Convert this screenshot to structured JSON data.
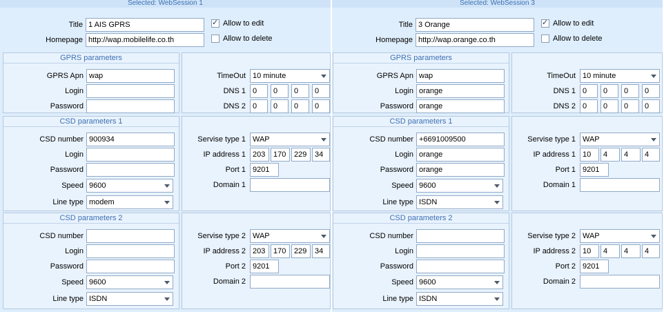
{
  "sessions": [
    {
      "header": "Selected: WebSession 1",
      "title_label": "Title",
      "title_value": "1 AIS GPRS",
      "homepage_label": "Homepage",
      "homepage_value": "http://wap.mobilelife.co.th",
      "allow_edit": {
        "label": "Allow to edit",
        "checked": true
      },
      "allow_delete": {
        "label": "Allow to delete",
        "checked": false
      },
      "gprs": {
        "title": "GPRS parameters",
        "apn_label": "GPRS Apn",
        "apn": "wap",
        "login_label": "Login",
        "login": "",
        "password_label": "Password",
        "password": "",
        "timeout_label": "TimeOut",
        "timeout": "10 minute",
        "dns1_label": "DNS 1",
        "dns1": [
          "0",
          "0",
          "0",
          "0"
        ],
        "dns2_label": "DNS 2",
        "dns2": [
          "0",
          "0",
          "0",
          "0"
        ]
      },
      "csd1": {
        "title": "CSD parameters 1",
        "number_label": "CSD number",
        "number": "900934",
        "login_label": "Login",
        "login": "",
        "password_label": "Password",
        "password": "",
        "speed_label": "Speed",
        "speed": "9600",
        "linetype_label": "Line type",
        "linetype": "modem",
        "service_label": "Servise type 1",
        "service": "WAP",
        "ip_label": "IP address 1",
        "ip": [
          "203",
          "170",
          "229",
          "34"
        ],
        "port_label": "Port 1",
        "port": "9201",
        "domain_label": "Domain 1",
        "domain": ""
      },
      "csd2": {
        "title": "CSD parameters 2",
        "number_label": "CSD number",
        "number": "",
        "login_label": "Login",
        "login": "",
        "password_label": "Password",
        "password": "",
        "speed_label": "Speed",
        "speed": "9600",
        "linetype_label": "Line type",
        "linetype": "ISDN",
        "service_label": "Servise type 2",
        "service": "WAP",
        "ip_label": "IP address 2",
        "ip": [
          "203",
          "170",
          "229",
          "34"
        ],
        "port_label": "Port 2",
        "port": "9201",
        "domain_label": "Domain 2",
        "domain": ""
      }
    },
    {
      "header": "Selected: WebSession 3",
      "title_label": "Title",
      "title_value": "3 Orange",
      "homepage_label": "Homepage",
      "homepage_value": "http://wap.orange.co.th",
      "allow_edit": {
        "label": "Allow to edit",
        "checked": true
      },
      "allow_delete": {
        "label": "Allow to delete",
        "checked": false
      },
      "gprs": {
        "title": "GPRS parameters",
        "apn_label": "GPRS Apn",
        "apn": "wap",
        "login_label": "Login",
        "login": "orange",
        "password_label": "Password",
        "password": "orange",
        "timeout_label": "TimeOut",
        "timeout": "10 minute",
        "dns1_label": "DNS 1",
        "dns1": [
          "0",
          "0",
          "0",
          "0"
        ],
        "dns2_label": "DNS 2",
        "dns2": [
          "0",
          "0",
          "0",
          "0"
        ]
      },
      "csd1": {
        "title": "CSD parameters 1",
        "number_label": "CSD number",
        "number": "+6691009500",
        "login_label": "Login",
        "login": "orange",
        "password_label": "Password",
        "password": "orange",
        "speed_label": "Speed",
        "speed": "9600",
        "linetype_label": "Line type",
        "linetype": "ISDN",
        "service_label": "Servise type 1",
        "service": "WAP",
        "ip_label": "IP address 1",
        "ip": [
          "10",
          "4",
          "4",
          "4"
        ],
        "port_label": "Port 1",
        "port": "9201",
        "domain_label": "Domain 1",
        "domain": ""
      },
      "csd2": {
        "title": "CSD parameters 2",
        "number_label": "CSD number",
        "number": "",
        "login_label": "Login",
        "login": "",
        "password_label": "Password",
        "password": "",
        "speed_label": "Speed",
        "speed": "9600",
        "linetype_label": "Line type",
        "linetype": "ISDN",
        "service_label": "Servise type 2",
        "service": "WAP",
        "ip_label": "IP address 2",
        "ip": [
          "10",
          "4",
          "4",
          "4"
        ],
        "port_label": "Port 2",
        "port": "9201",
        "domain_label": "Domain 2",
        "domain": ""
      }
    }
  ]
}
